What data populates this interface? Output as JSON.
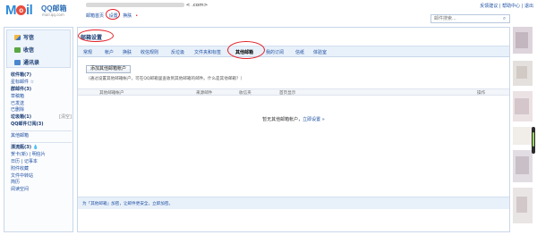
{
  "brand": {
    "logo_mail": "MaIl",
    "logo_o": "o",
    "logo_qq": "QQ邮箱",
    "logo_domain": "mail.qq.com"
  },
  "header": {
    "user_suffix": "<  .com>",
    "links": {
      "home": "邮箱首页",
      "settings": "设置",
      "skin": "换肤"
    },
    "right_links": "反馈建议 | 帮助中心 | 退出",
    "search_placeholder": "邮件搜索..."
  },
  "sidebar": {
    "compose": "写信",
    "inbox": "收信",
    "contacts": "通讯录",
    "folders": [
      {
        "label": "收件箱(7)",
        "bold": true
      },
      {
        "label": "星标邮件 ☆"
      },
      {
        "label": "群邮件(3)",
        "bold": true
      },
      {
        "label": "草稿箱"
      },
      {
        "label": "已发送"
      },
      {
        "label": "已删除"
      },
      {
        "label": "垃圾箱(1)",
        "bold": true,
        "side": "[清空]"
      },
      {
        "label": "QQ邮件订阅(3)",
        "bold": true
      }
    ],
    "folders2": [
      {
        "label": "其他邮箱"
      }
    ],
    "folders3": [
      {
        "label": "漂流瓶(3)",
        "bold": true,
        "extra": "💧"
      },
      {
        "label": "贺卡(新) | 明信片"
      },
      {
        "label": "日历 | 记事本"
      },
      {
        "label": "附件收藏"
      },
      {
        "label": "文件中转站"
      },
      {
        "label": "简历"
      },
      {
        "label": "阅读空间"
      }
    ]
  },
  "main": {
    "title": "邮箱设置",
    "tabs": [
      {
        "label": "常规"
      },
      {
        "label": "帐户"
      },
      {
        "label": "换肤"
      },
      {
        "label": "收信规则"
      },
      {
        "label": "反垃圾"
      },
      {
        "label": "文件夹和标签"
      },
      {
        "label": "其他邮箱",
        "active": true
      },
      {
        "label": "我的订阅"
      },
      {
        "label": "信纸"
      },
      {
        "label": "体验室"
      }
    ],
    "add_button": "添加其他邮箱帐户",
    "hint": "（通过设置其他邮箱帐户，可在QQ邮箱里查收到其他邮箱的邮件。什么是其他邮箱？）",
    "columns": {
      "account": "其他邮箱帐户",
      "source": "来源邮件",
      "folder": "收信夹",
      "display": "首页显示",
      "action": "操作"
    },
    "empty_text": "暂无其他邮箱帐户，",
    "empty_link": "立即设置 »",
    "bottom_text": "为「其他邮箱」加密，让邮件更安全，立即加密。"
  },
  "colors": {
    "annotation_red": "#e32028",
    "link_blue": "#1e50a2",
    "tab_bar": "#e8f0fa"
  }
}
